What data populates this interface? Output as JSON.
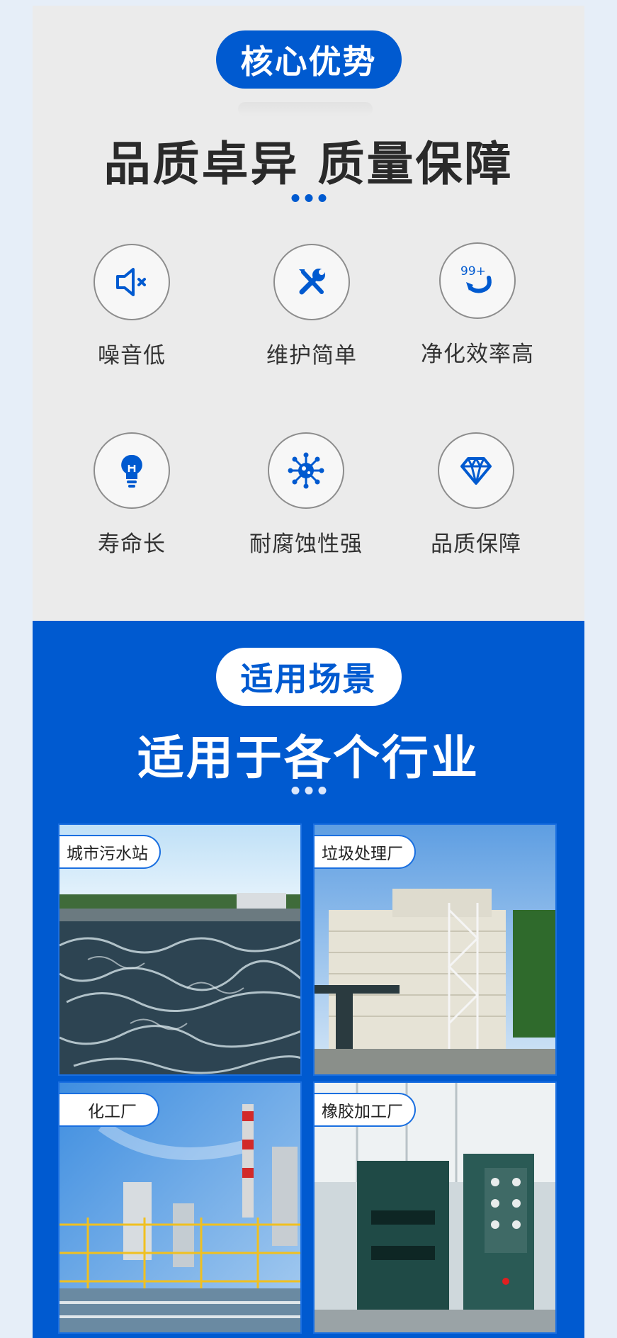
{
  "advantages": {
    "badge": "核心优势",
    "headline": "品质卓异 质量保障",
    "features": [
      {
        "label": "噪音低",
        "icon": "mute-speaker-icon"
      },
      {
        "label": "维护简单",
        "icon": "wrench-screwdriver-icon"
      },
      {
        "label": "净化效率高",
        "icon": "99-plus-arrow-icon"
      },
      {
        "label": "寿命长",
        "icon": "lightbulb-icon"
      },
      {
        "label": "耐腐蚀性强",
        "icon": "virus-icon"
      },
      {
        "label": "品质保障",
        "icon": "diamond-icon"
      }
    ],
    "badge_icon_text": "99+"
  },
  "scenarios": {
    "badge": "适用场景",
    "headline": "适用于各个行业",
    "items": [
      {
        "label": "城市污水站"
      },
      {
        "label": "垃圾处理厂"
      },
      {
        "label": "化工厂"
      },
      {
        "label": "橡胶加工厂"
      }
    ]
  },
  "colors": {
    "brand_blue": "#005ad0",
    "panel_gray": "#ebebeb",
    "page_bg": "#e6eef8"
  }
}
